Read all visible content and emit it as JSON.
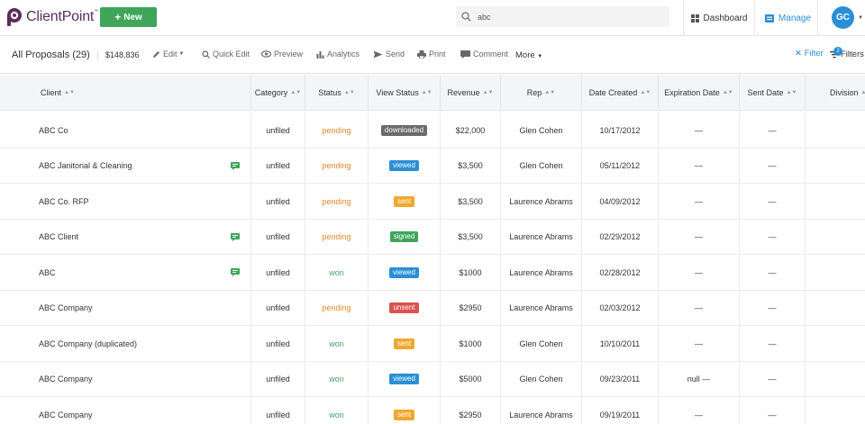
{
  "app": {
    "logo_text": "ClientPoint",
    "logo_tm": "™",
    "new_button": "New",
    "search_value": "abc",
    "nav_dashboard": "Dashboard",
    "nav_manage": "Manage",
    "avatar_initials": "GC",
    "accent": "#2a8fd6",
    "brand": "#5b2b5e",
    "green": "#3fa55b"
  },
  "toolbar": {
    "title": "All Proposals (29)",
    "total": "$148,836",
    "edit": "Edit",
    "quick_edit": "Quick Edit",
    "preview": "Preview",
    "analytics": "Analytics",
    "send": "Send",
    "print": "Print",
    "comment": "Comment",
    "more": "More",
    "filter": "Filter",
    "filters": "Filters",
    "filters_count": "2"
  },
  "table": {
    "columns": [
      "Client",
      "Category",
      "Status",
      "View Status",
      "Revenue",
      "Rep",
      "Date Created",
      "Expiration Date",
      "Sent Date",
      "Division"
    ],
    "rows": [
      {
        "client": "ABC Co",
        "note": false,
        "category": "unfiled",
        "status": "pending",
        "view_status": "downloaded",
        "revenue": "$22,000",
        "rep": "Glen Cohen",
        "date_created": "10/17/2012",
        "expiration": "—",
        "sent": "—"
      },
      {
        "client": "ABC Janitorial & Cleaning",
        "note": true,
        "category": "unfiled",
        "status": "pending",
        "view_status": "viewed",
        "revenue": "$3,500",
        "rep": "Glen Cohen",
        "date_created": "05/11/2012",
        "expiration": "—",
        "sent": "—"
      },
      {
        "client": "ABC Co. RFP",
        "note": false,
        "category": "unfiled",
        "status": "pending",
        "view_status": "sent",
        "revenue": "$3,500",
        "rep": "Laurence Abrams",
        "date_created": "04/09/2012",
        "expiration": "—",
        "sent": "—"
      },
      {
        "client": "ABC Client",
        "note": true,
        "category": "unfiled",
        "status": "pending",
        "view_status": "signed",
        "revenue": "$3,500",
        "rep": "Laurence Abrams",
        "date_created": "02/29/2012",
        "expiration": "—",
        "sent": "—"
      },
      {
        "client": "ABC",
        "note": true,
        "category": "unfiled",
        "status": "won",
        "view_status": "viewed",
        "revenue": "$1000",
        "rep": "Laurence Abrams",
        "date_created": "02/28/2012",
        "expiration": "—",
        "sent": "—"
      },
      {
        "client": "ABC Company",
        "note": false,
        "category": "unfiled",
        "status": "pending",
        "view_status": "unsent",
        "revenue": "$2950",
        "rep": "Laurence Abrams",
        "date_created": "02/03/2012",
        "expiration": "—",
        "sent": "—"
      },
      {
        "client": "ABC Company (duplicated)",
        "note": false,
        "category": "unfiled",
        "status": "won",
        "view_status": "sent",
        "revenue": "$1000",
        "rep": "Glen Cohen",
        "date_created": "10/10/2011",
        "expiration": "—",
        "sent": "—"
      },
      {
        "client": "ABC Company",
        "note": false,
        "category": "unfiled",
        "status": "won",
        "view_status": "viewed",
        "revenue": "$5000",
        "rep": "Glen Cohen",
        "date_created": "09/23/2011",
        "expiration": "null —",
        "sent": "—"
      },
      {
        "client": "ABC Company",
        "note": false,
        "category": "unfiled",
        "status": "won",
        "view_status": "sent",
        "revenue": "$2950",
        "rep": "Laurence Abrams",
        "date_created": "09/19/2011",
        "expiration": "—",
        "sent": "—"
      }
    ]
  }
}
